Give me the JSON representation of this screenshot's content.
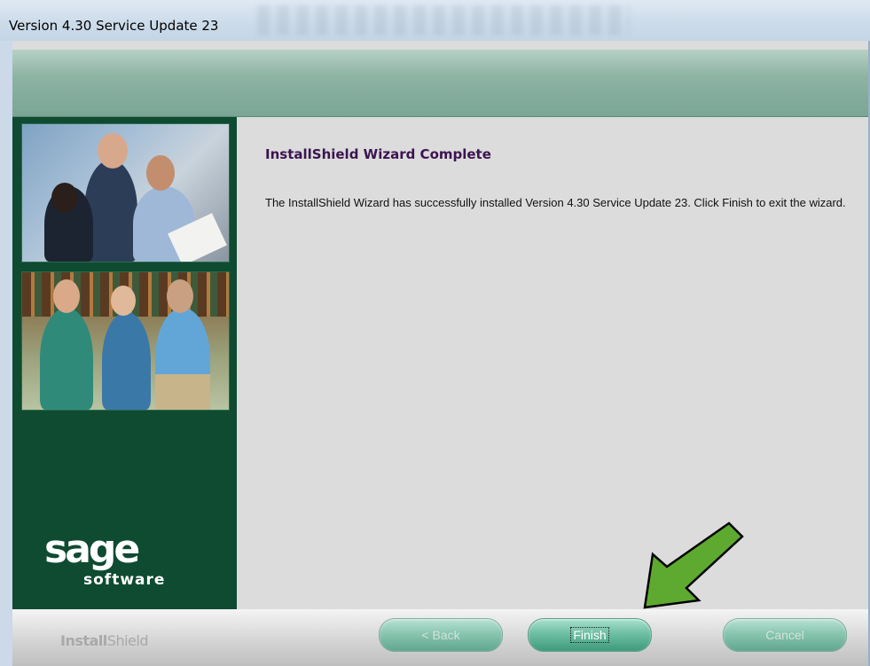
{
  "window": {
    "title": "Version 4.30 Service Update 23"
  },
  "content": {
    "heading": "InstallShield Wizard Complete",
    "message": "The InstallShield Wizard has successfully installed Version 4.30 Service Update 23.  Click Finish to exit the wizard."
  },
  "branding": {
    "logo_main": "sage",
    "logo_sub": "software",
    "footer_brand_bold": "Install",
    "footer_brand_light": "Shield"
  },
  "buttons": {
    "back": "< Back",
    "finish": "Finish",
    "cancel": "Cancel"
  },
  "colors": {
    "sidebar": "#0f4b31",
    "title_text": "#3b1450",
    "button": "#6ebfa3",
    "annotation_arrow": "#5ea92f"
  },
  "icons": {
    "annotation": "arrow-pointing-to-finish"
  }
}
